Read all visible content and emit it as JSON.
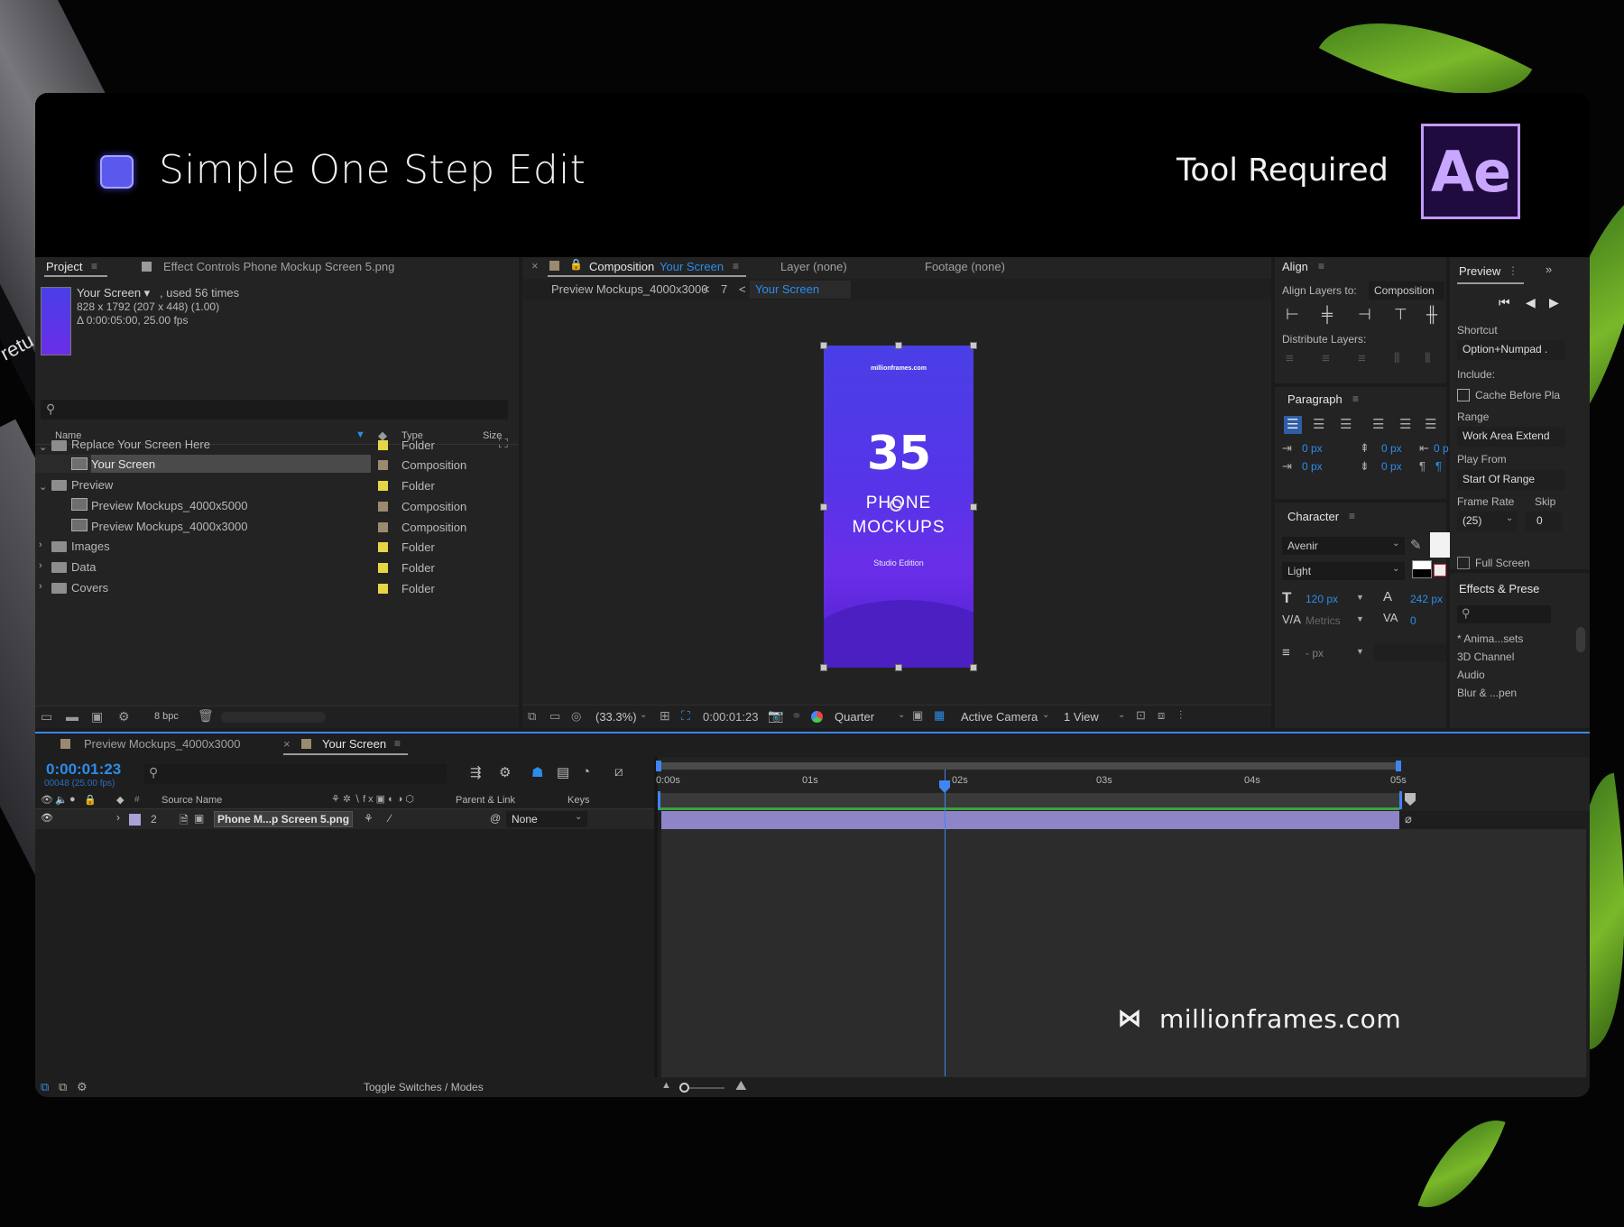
{
  "banner": {
    "title": "Simple One Step Edit",
    "tool_label": "Tool Required",
    "app_logo": "Ae",
    "accent_color": "#5b58ee"
  },
  "project_panel": {
    "tab_label": "Project",
    "effect_controls_label": "Effect Controls Phone Mockup Screen 5.png",
    "item_name": "Your Screen ▾",
    "item_used": ", used 56 times",
    "item_dims": "828 x 1792  (207 x 448) (1.00)",
    "item_duration": "Δ 0:00:05:00, 25.00 fps",
    "columns": {
      "name": "Name",
      "type": "Type",
      "size": "Size"
    },
    "rows": [
      {
        "name": "Replace Your Screen Here",
        "type": "Folder"
      },
      {
        "name": "Your Screen",
        "type": "Composition"
      },
      {
        "name": "Preview",
        "type": "Folder"
      },
      {
        "name": "Preview Mockups_4000x5000",
        "type": "Composition"
      },
      {
        "name": "Preview Mockups_4000x3000",
        "type": "Composition"
      },
      {
        "name": "Images",
        "type": "Folder"
      },
      {
        "name": "Data",
        "type": "Folder"
      },
      {
        "name": "Covers",
        "type": "Folder"
      }
    ],
    "bpc": "8 bpc"
  },
  "comp_panel": {
    "composition_prefix": "Composition",
    "composition_name": "Your Screen",
    "layer_tab": "Layer (none)",
    "footage_tab": "Footage (none)",
    "breadcrumb_1": "Preview Mockups_4000x3000",
    "breadcrumb_sep1": "<",
    "breadcrumb_num": "7",
    "breadcrumb_sep2": "<",
    "breadcrumb_2": "Your Screen",
    "zoom": "(33.3%)",
    "timecode": "0:00:01:23",
    "resolution": "Quarter",
    "camera": "Active Camera",
    "views": "1 View",
    "phone": {
      "site": "millionframes.com",
      "number": "35",
      "line1": "PHONE",
      "line2": "MOCKUPS",
      "sub": "Studio Edition"
    }
  },
  "align_panel": {
    "title": "Align",
    "align_to_label": "Align Layers to:",
    "align_to_value": "Composition",
    "distribute_label": "Distribute Layers:"
  },
  "paragraph_panel": {
    "title": "Paragraph",
    "values": [
      "0 px",
      "0 px",
      "0 p",
      "0 px",
      "0 px"
    ]
  },
  "character_panel": {
    "title": "Character",
    "font": "Avenir",
    "style": "Light",
    "size": "120 px",
    "leading": "242 px",
    "kerning": "Metrics",
    "tracking": "0",
    "unit": "- px"
  },
  "preview_panel": {
    "title": "Preview",
    "shortcut_label": "Shortcut",
    "shortcut_value": "Option+Numpad .",
    "include_label": "Include:",
    "cache_label": "Cache Before Pla",
    "range_label": "Range",
    "range_value": "Work Area Extend",
    "play_from_label": "Play From",
    "play_from_value": "Start Of Range",
    "frame_rate_label": "Frame Rate",
    "skip_label": "Skip",
    "frame_rate_value": "(25)",
    "skip_value": "0",
    "fullscreen_label": "Full Screen"
  },
  "effects_panel": {
    "title": "Effects & Prese",
    "items": [
      "* Anima...sets",
      "3D Channel",
      "Audio",
      "Blur & ...pen"
    ]
  },
  "timeline": {
    "tab1": "Preview Mockups_4000x3000",
    "tab2": "Your Screen",
    "timecode": "0:00:01:23",
    "frames": "00048 (25.00 fps)",
    "col_source": "Source Name",
    "col_parent": "Parent & Link",
    "col_keys": "Keys",
    "layer_num": "2",
    "layer_name": "Phone M...p Screen 5.png",
    "parent_value": "None",
    "ruler": [
      "0:00s",
      "01s",
      "02s",
      "03s",
      "04s",
      "05s"
    ],
    "toggle_label": "Toggle Switches / Modes",
    "playhead_seconds": 1.92
  },
  "watermark": "millionframes.com"
}
